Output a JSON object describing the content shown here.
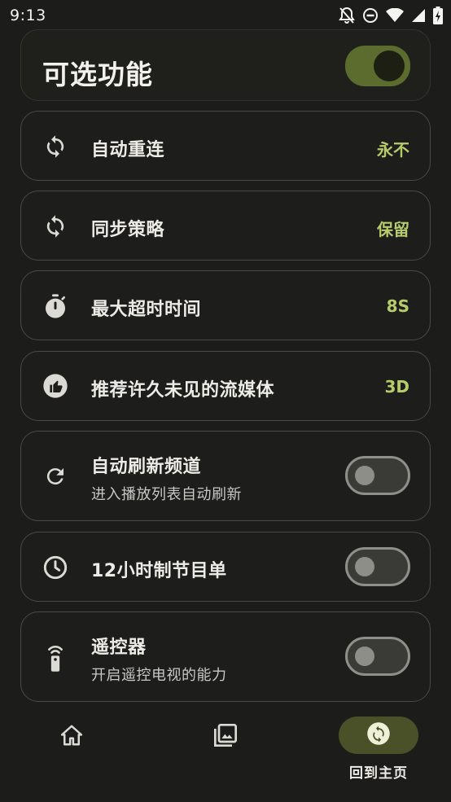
{
  "status_bar": {
    "time": "9:13",
    "icons": [
      "notifications-off-icon",
      "do-not-disturb-icon",
      "wifi-icon",
      "signal-icon",
      "battery-charging-icon"
    ]
  },
  "header": {
    "title": "可选功能",
    "toggle_on": true
  },
  "settings": [
    {
      "icon": "sync-icon",
      "title": "自动重连",
      "value": "永不"
    },
    {
      "icon": "sync-icon",
      "title": "同步策略",
      "value": "保留"
    },
    {
      "icon": "timer-icon",
      "title": "最大超时时间",
      "value": "8S"
    },
    {
      "icon": "thumb-up-icon",
      "title": "推荐许久未见的流媒体",
      "value": "3D"
    },
    {
      "icon": "refresh-icon",
      "title": "自动刷新频道",
      "subtitle": "进入播放列表自动刷新",
      "toggle_on": false
    },
    {
      "icon": "clock-icon",
      "title": "12小时制节目单",
      "toggle_on": false
    },
    {
      "icon": "remote-control-icon",
      "title": "遥控器",
      "subtitle": "开启遥控电视的能力",
      "toggle_on": false
    }
  ],
  "bottom_nav": {
    "items": [
      {
        "icon": "home-icon",
        "label": ""
      },
      {
        "icon": "photo-library-icon",
        "label": ""
      },
      {
        "icon": "sync-circle-icon",
        "label": "回到主页",
        "active": true
      }
    ]
  },
  "colors": {
    "background": "#1c1c1a",
    "accent_value": "#b6cc6a",
    "toggle_on_track": "#5c6b2e",
    "nav_active_pill": "#4a5128"
  }
}
